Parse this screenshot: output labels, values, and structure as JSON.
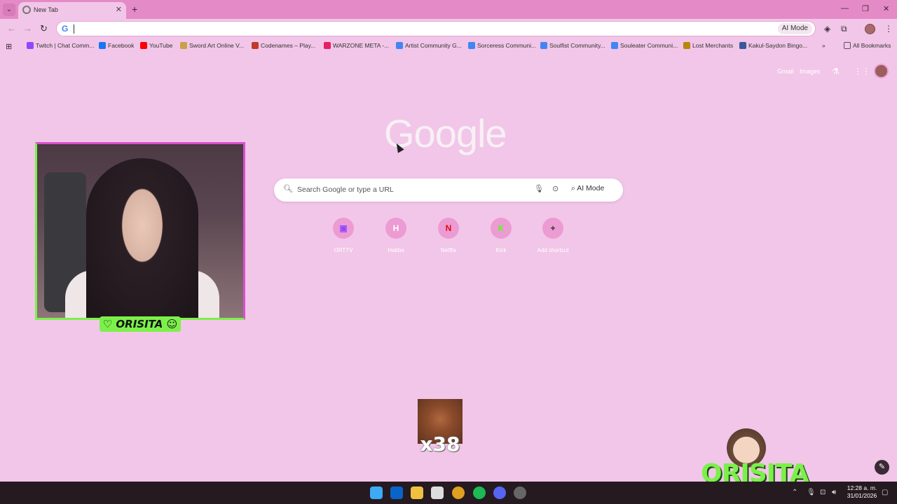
{
  "browser": {
    "tab_title": "New Tab",
    "omnibox_ai_label": "AI Mode",
    "bookmarks": [
      {
        "label": "Twitch | Chat Comm...",
        "color": "#9146ff"
      },
      {
        "label": "Facebook",
        "color": "#1877f2"
      },
      {
        "label": "YouTube",
        "color": "#ff0000"
      },
      {
        "label": "Sword Art Online V...",
        "color": "#c8a048"
      },
      {
        "label": "Codenames – Play...",
        "color": "#c0392b"
      },
      {
        "label": "WARZONE META -...",
        "color": "#e91e63"
      },
      {
        "label": "Artist Community G...",
        "color": "#4285f4"
      },
      {
        "label": "Sorceress Communi...",
        "color": "#4285f4"
      },
      {
        "label": "Soulfist Community...",
        "color": "#4285f4"
      },
      {
        "label": "Souleater Communi...",
        "color": "#4285f4"
      },
      {
        "label": "Lost Merchants",
        "color": "#b8860b"
      },
      {
        "label": "Kakul-Saydon Bingo...",
        "color": "#3b5998"
      }
    ],
    "all_bookmarks_label": "All Bookmarks"
  },
  "ntp": {
    "gmail_label": "Gmail",
    "images_label": "Images",
    "google_logo": "Google",
    "search_placeholder": "Search Google or type a URL",
    "search_ai_label": "AI Mode",
    "shortcuts": [
      {
        "label": "ORTTV",
        "glyph": "▣",
        "glyph_color": "#9146ff"
      },
      {
        "label": "Habbo",
        "glyph": "H",
        "glyph_color": "#ffffff"
      },
      {
        "label": "Netflix",
        "glyph": "N",
        "glyph_color": "#e50914"
      },
      {
        "label": "Kick",
        "glyph": "K",
        "glyph_color": "#53fc18"
      },
      {
        "label": "Add shortcut",
        "glyph": "+",
        "glyph_color": "#333333"
      }
    ]
  },
  "overlay": {
    "webcam_name": "♡ ORISITA ☺",
    "emote_count": "x38",
    "brand_text": "ORISITA"
  },
  "taskbar": {
    "time": "12:28 a. m.",
    "date": "31/01/2026"
  }
}
